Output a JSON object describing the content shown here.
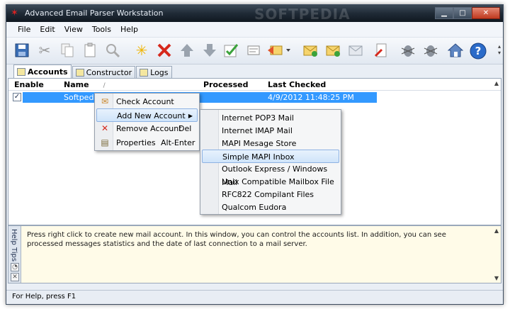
{
  "window": {
    "title": "Advanced Email Parser Workstation",
    "watermark": "SOFTPEDIA"
  },
  "menu": [
    "File",
    "Edit",
    "View",
    "Tools",
    "Help"
  ],
  "toolbar": {
    "buttons": [
      "save-icon",
      "cut-icon",
      "copy-icon",
      "paste-icon",
      "find-icon",
      "new-icon",
      "delete-icon",
      "move-up-icon",
      "move-down-icon",
      "check-icon",
      "properties-icon",
      "import-icon",
      "add-mail-icon",
      "add-folder-icon",
      "mail-send-icon",
      "clear-icon",
      "bug-icon",
      "bug-report-icon",
      "home-icon",
      "help-icon"
    ]
  },
  "tabs": [
    "Accounts",
    "Constructor",
    "Logs"
  ],
  "list": {
    "columns": {
      "enable": "Enable",
      "name": "Name",
      "sort_mark": "/",
      "processed": "Processed",
      "last_checked": "Last Checked"
    },
    "rows": [
      {
        "enabled": true,
        "name": "Softpedia",
        "processed": "",
        "last_checked": "4/9/2012 11:48:25 PM"
      }
    ]
  },
  "context_menu": {
    "items": [
      {
        "label": "Check Account",
        "shortcut": ""
      },
      {
        "label": "Add New Account",
        "shortcut": ""
      },
      {
        "label": "Remove Account",
        "shortcut": "Del"
      },
      {
        "label": "Properties",
        "shortcut": "Alt-Enter"
      }
    ]
  },
  "submenu": {
    "items": [
      "Internet POP3 Mail",
      "Internet IMAP Mail",
      "MAPI Mesage Store",
      "Simple MAPI Inbox",
      "Outlook Express / Windows Mail",
      "Unix Compatible Mailbox File",
      "RFC822 Compilant Files",
      "Qualcom Eudora"
    ],
    "highlighted": "Simple MAPI Inbox"
  },
  "help": {
    "side_label": "Help Tips",
    "text": "Press right click to create new mail account. In this window, you can control the accounts list. In addition, you can see processed messages statistics and the date of last connection to a mail server."
  },
  "status": "For Help, press F1",
  "colors": {
    "selection": "#3399ff",
    "titlebar": "#1f2a36",
    "help_bg": "#fffbe8"
  }
}
